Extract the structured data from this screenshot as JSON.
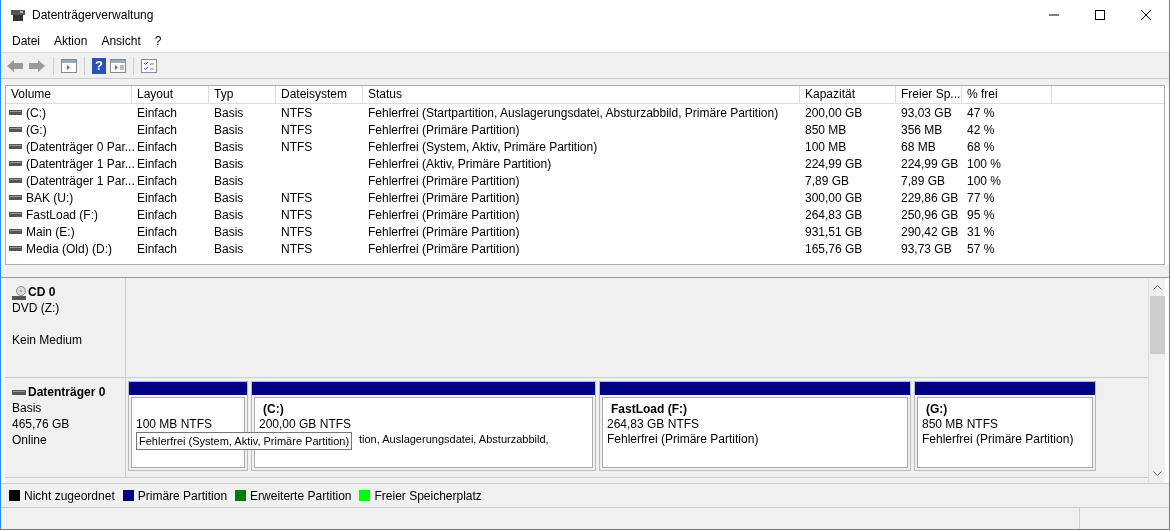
{
  "window": {
    "title": "Datenträgerverwaltung"
  },
  "menu": [
    "Datei",
    "Aktion",
    "Ansicht",
    "?"
  ],
  "toolbar": {
    "help_glyph": "?"
  },
  "table": {
    "columns": [
      "Volume",
      "Layout",
      "Typ",
      "Dateisystem",
      "Status",
      "Kapazität",
      "Freier Sp...",
      "% frei"
    ],
    "rows": [
      [
        "(C:)",
        "Einfach",
        "Basis",
        "NTFS",
        "Fehlerfrei (Startpartition, Auslagerungsdatei, Absturzabbild, Primäre Partition)",
        "200,00 GB",
        "93,03 GB",
        "47 %"
      ],
      [
        "(G:)",
        "Einfach",
        "Basis",
        "NTFS",
        "Fehlerfrei (Primäre Partition)",
        "850 MB",
        "356 MB",
        "42 %"
      ],
      [
        "(Datenträger 0 Par...",
        "Einfach",
        "Basis",
        "NTFS",
        "Fehlerfrei (System, Aktiv, Primäre Partition)",
        "100 MB",
        "68 MB",
        "68 %"
      ],
      [
        "(Datenträger 1 Par...",
        "Einfach",
        "Basis",
        "",
        "Fehlerfrei (Aktiv, Primäre Partition)",
        "224,99 GB",
        "224,99 GB",
        "100 %"
      ],
      [
        "(Datenträger 1 Par...",
        "Einfach",
        "Basis",
        "",
        "Fehlerfrei (Primäre Partition)",
        "7,89 GB",
        "7,89 GB",
        "100 %"
      ],
      [
        "BAK (U:)",
        "Einfach",
        "Basis",
        "NTFS",
        "Fehlerfrei (Primäre Partition)",
        "300,00 GB",
        "229,86 GB",
        "77 %"
      ],
      [
        "FastLoad (F:)",
        "Einfach",
        "Basis",
        "NTFS",
        "Fehlerfrei (Primäre Partition)",
        "264,83 GB",
        "250,96 GB",
        "95 %"
      ],
      [
        "Main (E:)",
        "Einfach",
        "Basis",
        "NTFS",
        "Fehlerfrei (Primäre Partition)",
        "931,51 GB",
        "290,42 GB",
        "31 %"
      ],
      [
        "Media (Old) (D:)",
        "Einfach",
        "Basis",
        "NTFS",
        "Fehlerfrei (Primäre Partition)",
        "165,76 GB",
        "93,73 GB",
        "57 %"
      ]
    ]
  },
  "disks": [
    {
      "kind": "cdrom",
      "name": "CD 0",
      "lines": [
        "DVD (Z:)",
        "Kein Medium"
      ]
    },
    {
      "kind": "disk",
      "name": "Datenträger 0",
      "lines": [
        "Basis",
        "465,76 GB",
        "Online"
      ],
      "partitions": [
        {
          "size": "100 MB NTFS",
          "color": "#000080"
        },
        {
          "name": "(C:)",
          "size": "200,00 GB NTFS",
          "status": "tion, Auslagerungsdatei, Absturzabbild,",
          "color": "#000080"
        },
        {
          "name": "FastLoad  (F:)",
          "size": "264,83 GB NTFS",
          "status": "Fehlerfrei (Primäre Partition)",
          "color": "#000080"
        },
        {
          "name": "(G:)",
          "size": "850 MB NTFS",
          "status": "Fehlerfrei (Primäre Partition)",
          "color": "#000080"
        }
      ]
    }
  ],
  "tooltip": "Fehlerfrei (System, Aktiv, Primäre Partition)",
  "legend": [
    {
      "label": "Nicht zugeordnet",
      "color": "#000000"
    },
    {
      "label": "Primäre Partition",
      "color": "#000080"
    },
    {
      "label": "Erweiterte Partition",
      "color": "#008000"
    },
    {
      "label": "Freier Speicherplatz",
      "color": "#00ff00"
    }
  ]
}
